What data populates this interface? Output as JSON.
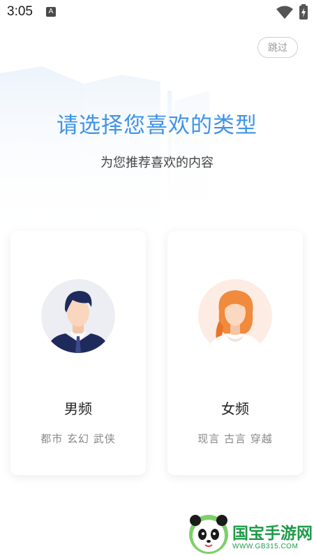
{
  "status_bar": {
    "time": "3:05",
    "app_icon": "A",
    "wifi_icon": "wifi-icon",
    "battery_icon": "battery-charging-icon"
  },
  "skip_label": "跳过",
  "title": "请选择您喜欢的类型",
  "subtitle": "为您推荐喜欢的内容",
  "options": [
    {
      "label": "男频",
      "tags": "都市 玄幻 武侠",
      "avatar_icon": "male-avatar-icon"
    },
    {
      "label": "女频",
      "tags": "现言 古言 穿越",
      "avatar_icon": "female-avatar-icon"
    }
  ],
  "watermark": {
    "text": "国宝手游网",
    "url": "WWW.GB315.COM"
  },
  "colors": {
    "accent": "#3f93e8",
    "watermark": "#1f9a4a"
  }
}
